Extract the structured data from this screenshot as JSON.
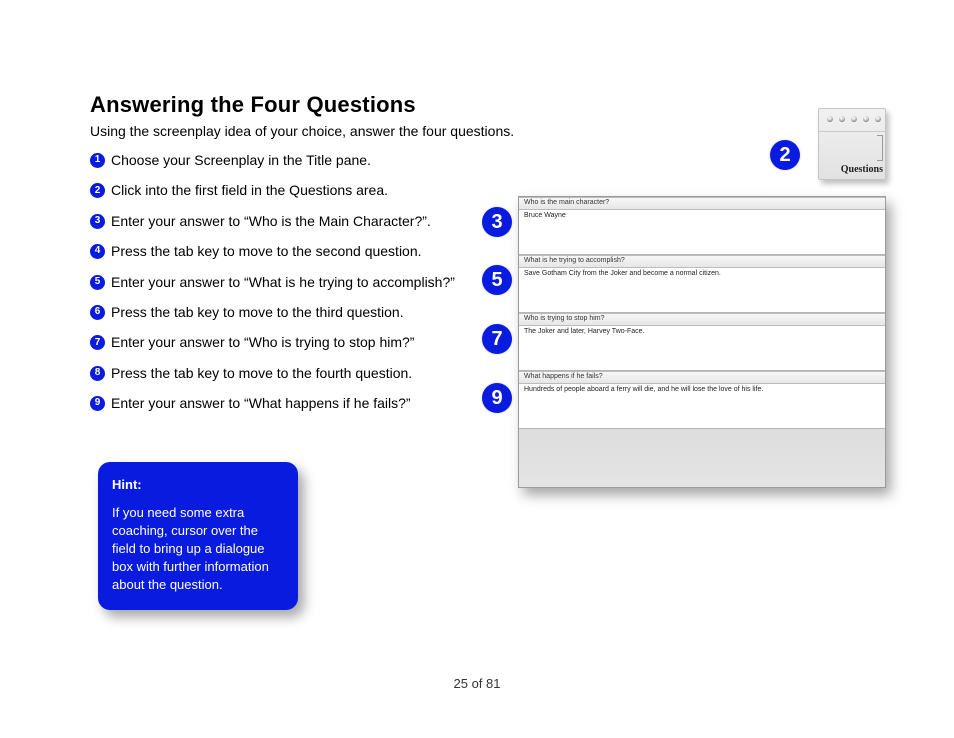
{
  "heading": "Answering the Four Questions",
  "intro": "Using the screenplay idea of your choice, answer the four questions.",
  "steps": [
    "Choose your Screenplay in the Title pane.",
    "Click into the first field in the Questions area.",
    "Enter your answer to “Who is the Main Character?”.",
    "Press the tab key to move to the second question.",
    "Enter your answer to “What is he trying to accomplish?”",
    "Press the tab key to move to the third question.",
    "Enter your answer to “Who is trying to stop him?”",
    "Press the tab key to move to the fourth question.",
    "Enter your answer to “What happens if he fails?”"
  ],
  "hint": {
    "title": "Hint:",
    "body": "If you need some extra coaching, cursor over the field to bring up a dialogue box with further information about the question."
  },
  "callouts": {
    "c2": "2",
    "c3": "3",
    "c5": "5",
    "c7": "7",
    "c9": "9"
  },
  "tab": {
    "label": "Questions"
  },
  "panel": {
    "q1": {
      "label": "Who is the main character?",
      "answer": "Bruce Wayne"
    },
    "q2": {
      "label": "What is he trying to accomplish?",
      "answer": "Save Gotham City from the Joker and become a normal citizen."
    },
    "q3": {
      "label": "Who is trying to stop him?",
      "answer": "The Joker and later, Harvey Two-Face."
    },
    "q4": {
      "label": "What happens if he fails?",
      "answer": "Hundreds of people aboard a ferry will die, and he will lose the love of his life."
    }
  },
  "pager": "25 of 81"
}
